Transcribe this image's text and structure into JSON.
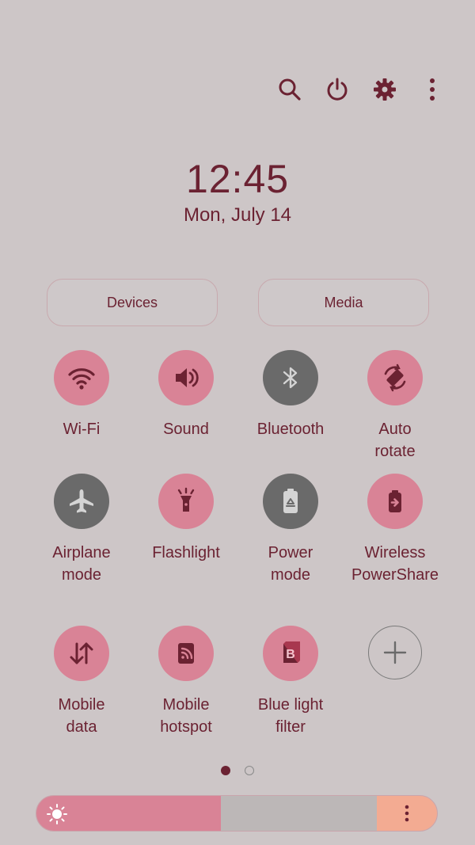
{
  "clock": {
    "time": "12:45",
    "date": "Mon, July 14"
  },
  "top_icons": [
    "search-icon",
    "power-icon",
    "settings-gear-icon",
    "more-options-icon"
  ],
  "pills": {
    "devices": "Devices",
    "media": "Media"
  },
  "tiles": [
    {
      "label": "Wi-Fi",
      "state": "on",
      "icon": "wifi-icon"
    },
    {
      "label": "Sound",
      "state": "on",
      "icon": "speaker-icon"
    },
    {
      "label": "Bluetooth",
      "state": "off",
      "icon": "bluetooth-icon"
    },
    {
      "label": "Auto\nrotate",
      "state": "on",
      "icon": "auto-rotate-icon"
    },
    {
      "label": "Airplane\nmode",
      "state": "off",
      "icon": "airplane-icon"
    },
    {
      "label": "Flashlight",
      "state": "on",
      "icon": "flashlight-icon"
    },
    {
      "label": "Power\nmode",
      "state": "off",
      "icon": "battery-recycle-icon"
    },
    {
      "label": "Wireless\nPowerShare",
      "state": "on",
      "icon": "wireless-powershare-icon"
    },
    {
      "label": "Mobile\ndata",
      "state": "on",
      "icon": "mobile-data-arrows-icon"
    },
    {
      "label": "Mobile\nhotspot",
      "state": "on",
      "icon": "hotspot-icon"
    },
    {
      "label": "Blue light\nfilter",
      "state": "on",
      "icon": "blue-light-filter-icon"
    },
    {
      "label": "",
      "state": "add",
      "icon": "add-icon"
    }
  ],
  "pager": {
    "pages": 2,
    "current": 1
  },
  "brightness": {
    "level": 0.46
  },
  "colors": {
    "accent": "#d98396",
    "text": "#6b2232",
    "off": "#6a6a6a",
    "background": "#cdc6c7",
    "options": "#f3ab92"
  }
}
